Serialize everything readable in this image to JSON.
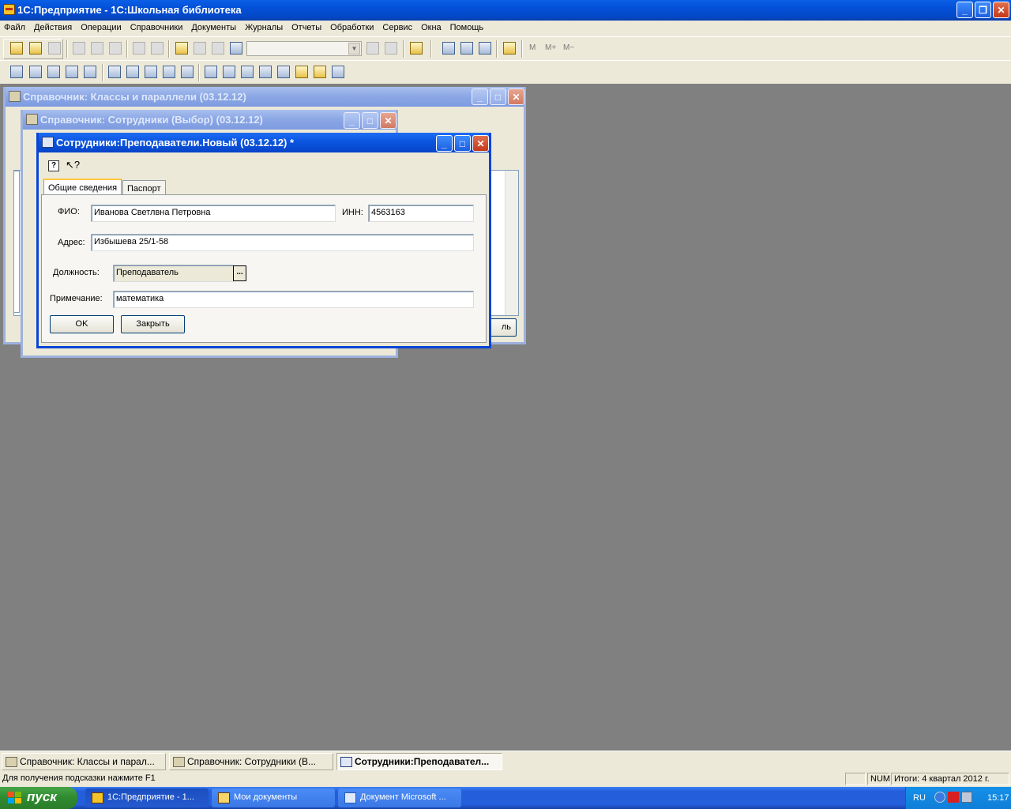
{
  "app": {
    "title": "1С:Предприятие - 1С:Школьная библиотека"
  },
  "menu": [
    "Файл",
    "Действия",
    "Операции",
    "Справочники",
    "Документы",
    "Журналы",
    "Отчеты",
    "Обработки",
    "Сервис",
    "Окна",
    "Помощь"
  ],
  "toolbar": {
    "memory_buttons": [
      "M",
      "M+",
      "M−"
    ]
  },
  "windows": {
    "classes_title": "Справочник: Классы и параллели (03.12.12)",
    "staff_title": "Справочник: Сотрудники (Выбор) (03.12.12)",
    "partial_button_text": "ль"
  },
  "dialog": {
    "title": "Сотрудники:Преподаватели.Новый (03.12.12) *",
    "tabs": [
      "Общие сведения",
      "Паспорт"
    ],
    "fio_label": "ФИО:",
    "fio_value": "Иванова Светлвна Петровна",
    "inn_label": "ИНН:",
    "inn_value": "4563163",
    "address_label": "Адрес:",
    "address_value": "Избышева 25/1-58",
    "position_label": "Должность:",
    "position_value": "Преподаватель",
    "position_button": "...",
    "note_label": "Примечание:",
    "note_value": "математика",
    "ok_label": "OK",
    "close_label": "Закрыть"
  },
  "mdi_tabs": [
    "Справочник: Классы и парал...",
    "Справочник: Сотрудники (В...",
    "Сотрудники:Преподавател..."
  ],
  "status": {
    "hint": "Для получения подсказки нажмите F1",
    "num": "NUM",
    "totals": "Итоги: 4 квартал 2012 г."
  },
  "taskbar": {
    "start": "пуск",
    "tasks": [
      "1С:Предприятие - 1...",
      "Мои документы",
      "Документ Microsoft ..."
    ],
    "lang": "RU",
    "time": "15:17"
  }
}
